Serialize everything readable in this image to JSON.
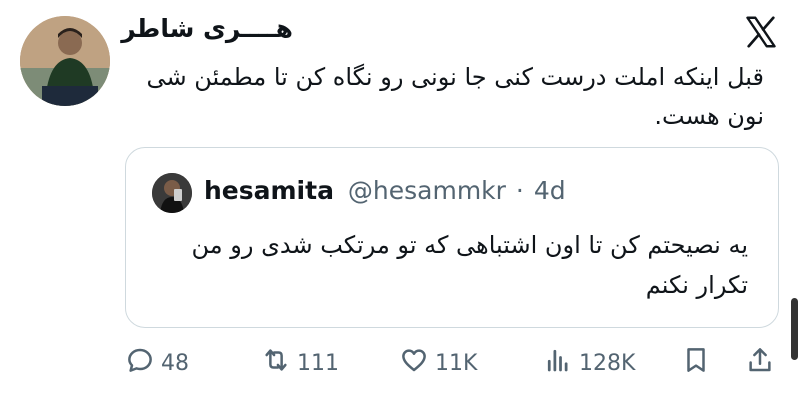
{
  "tweet": {
    "author_name": "هــــری شاطر",
    "text": "قبل اینکه املت درست کنی جا نونی رو نگاه کن تا مطمئن شی نون هست."
  },
  "quote": {
    "name": "hesamita",
    "handle": "@hesammkr",
    "separator": "·",
    "time": "4d",
    "text": "یه نصیحتم کن تا اون اشتباهی که تو مرتکب شدی رو من تکرار نکنم"
  },
  "actions": {
    "replies": "48",
    "reposts": "111",
    "likes": "11K",
    "views": "128K"
  },
  "icons": [
    "x-logo-icon",
    "reply-icon",
    "repost-icon",
    "like-icon",
    "views-icon",
    "bookmark-icon",
    "share-icon"
  ],
  "colors": {
    "text": "#0f1419",
    "secondary": "#536471",
    "border": "#cfd9de"
  }
}
